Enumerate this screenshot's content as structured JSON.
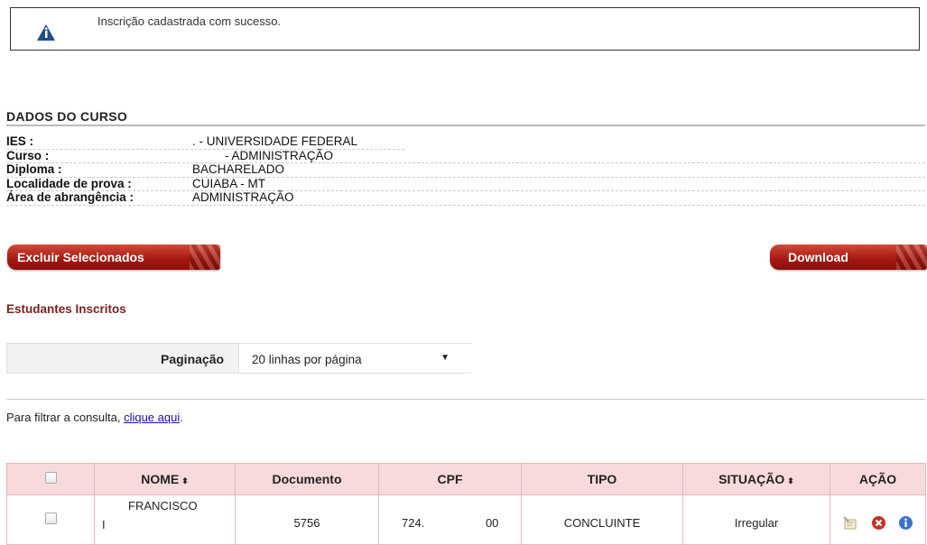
{
  "notice": {
    "message": "Inscrição cadastrada com sucesso."
  },
  "course": {
    "section_title": "DADOS DO CURSO",
    "fields": [
      {
        "label": "IES :",
        "value": ". - UNIVERSIDADE FEDERAL"
      },
      {
        "label": "Curso :",
        "value": "- ADMINISTRAÇÃO"
      },
      {
        "label": "Diploma :",
        "value": "BACHARELADO"
      },
      {
        "label": "Localidade de prova :",
        "value": "CUIABA - MT"
      },
      {
        "label": "Área de abrangência :",
        "value": "ADMINISTRAÇÃO"
      }
    ]
  },
  "actions": {
    "delete_selected_label": "Excluir Selecionados",
    "download_label": "Download"
  },
  "students_title": "Estudantes Inscritos",
  "pagination": {
    "label": "Paginação",
    "selected": "20 linhas por página"
  },
  "filter": {
    "prefix": "Para filtrar a consulta, ",
    "link_text": "clique aqui",
    "suffix": "."
  },
  "table": {
    "headers": {
      "nome": "NOME",
      "documento": "Documento",
      "cpf": "CPF",
      "tipo": "TIPO",
      "situacao": "SITUAÇÃO",
      "acao": "AÇÃO"
    },
    "sort_symbol": "⬍",
    "rows": [
      {
        "nome_line1": "FRANCISCO",
        "nome_line2": "I",
        "documento": "5756",
        "cpf_start": "724.",
        "cpf_end": "00",
        "tipo": "CONCLUINTE",
        "situacao": "Irregular"
      }
    ]
  },
  "icons": {
    "notice": "info-warning-icon",
    "row_actions": [
      "edit-card-icon",
      "delete-icon",
      "info-icon"
    ]
  },
  "colors": {
    "button_red": "#a3170f",
    "table_header_bg": "#f9dada",
    "subtitle": "#7a1f1f",
    "link": "#1a0dab"
  }
}
